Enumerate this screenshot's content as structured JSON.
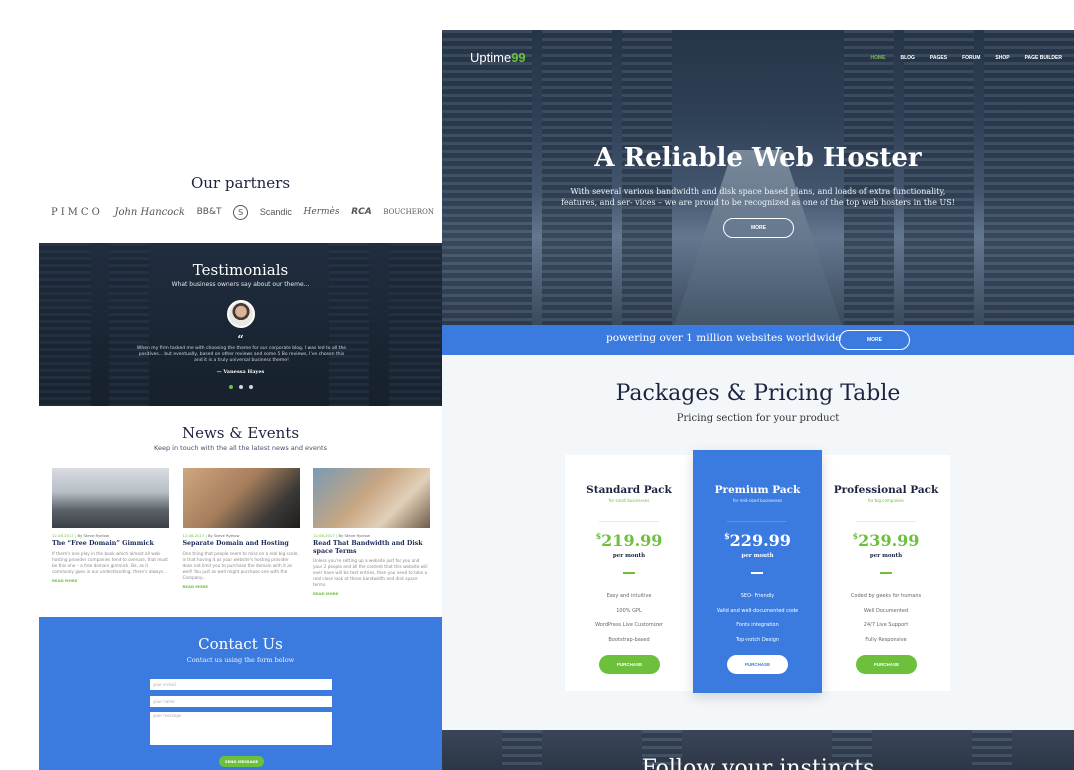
{
  "left": {
    "partners": {
      "title": "Our partners",
      "logos": [
        "PIMCO",
        "John Hancock",
        "BB&T",
        "S",
        "Scandic",
        "Hermès",
        "RCA",
        "BOUCHERON"
      ]
    },
    "testimonials": {
      "title": "Testimonials",
      "subtitle": "What business owners say about our theme...",
      "quote_mark": "“",
      "quote": "When my firm tasked me with choosing the theme for our corporate blog, I was led to all the positives... but eventually, based on other reviews and some 5 Bo reviews, I've chosen this and it is a truly universal business theme!",
      "author": "— Vanessa Hayes"
    },
    "news": {
      "title": "News & Events",
      "subtitle": "Keep in touch with the all the latest news and events",
      "items": [
        {
          "date": "12.08.2017",
          "author": "By Steve Ryelow",
          "title": "The “Free Domain” Gimmick",
          "body": "If there's one ploy in the book which almost all web hosting provider companies tend to overuse, that must be this one – a free domain gimmick. Be, as it commonly goes in our understanding, there's always...",
          "more": "READ MORE"
        },
        {
          "date": "12.08.2017",
          "author": "By Steve Ryelow",
          "title": "Separate Domain and Hosting",
          "body": "One thing that people seem to miss on a real big scale, is that having it as your website's hosting provider does not limit you to purchase the domain with it as well! You just as well might purchase one with the Company...",
          "more": "READ MORE"
        },
        {
          "date": "12.08.2017",
          "author": "By Steve Ryelow",
          "title": "Read That Bandwidth and Disk space Terms",
          "body": "Unless you're setting up a website just for you and your 2 people and all the content that this website will ever have will be text entries, then you need to take a real close look at those bandwidth and disk space terms.",
          "more": "READ MORE"
        }
      ]
    },
    "contact": {
      "title": "Contact Us",
      "subtitle": "Contact us using the form below",
      "name_placeholder": "your e-mail",
      "email_placeholder": "your name",
      "message_placeholder": "your message",
      "send_label": "SEND MESSAGE"
    }
  },
  "right": {
    "brand": "Uptime",
    "brand_accent": "99",
    "nav": [
      "HOME",
      "BLOG",
      "PAGES",
      "FORUM",
      "SHOP",
      "PAGE BUILDER"
    ],
    "hero": {
      "title": "A Reliable Web Hoster",
      "subtitle": "With several various bandwidth and disk space based plans, and loads of extra functionality, features, and ser- vices – we are proud to be recognized as one of the top web hosters in the US!",
      "button": "MORE"
    },
    "powerbar": {
      "text": "powering over 1 million websites worldwide",
      "button": "MORE"
    },
    "pricing": {
      "title": "Packages & Pricing Table",
      "subtitle": "Pricing section for your product",
      "plans": [
        {
          "name": "Standard Pack",
          "desc": "for small businesses",
          "currency": "$",
          "price": "219.99",
          "period": "per month",
          "features": [
            "Easy and intuitive",
            "100% GPL",
            "WordPress Live Customizer",
            "Bootstrap-based"
          ],
          "button": "PURCHASE"
        },
        {
          "name": "Premium Pack",
          "desc": "for mid-sized businesses",
          "currency": "$",
          "price": "229.99",
          "period": "per month",
          "features": [
            "SEO- Friendly",
            "Valid and well-documented code",
            "Fonts integration",
            "Top-notch Design"
          ],
          "button": "PURCHASE"
        },
        {
          "name": "Professional Pack",
          "desc": "for big companies",
          "currency": "$",
          "price": "239.99",
          "period": "per month",
          "features": [
            "Coded by geeks for humans",
            "Well Documented",
            "24/7 Live Support",
            "Fully Responsive"
          ],
          "button": "PURCHASE"
        }
      ]
    },
    "instincts": {
      "title": "Follow your instincts"
    }
  },
  "colors": {
    "accent_green": "#6cc03c",
    "accent_blue": "#3b7be0",
    "navy": "#1c2440"
  }
}
